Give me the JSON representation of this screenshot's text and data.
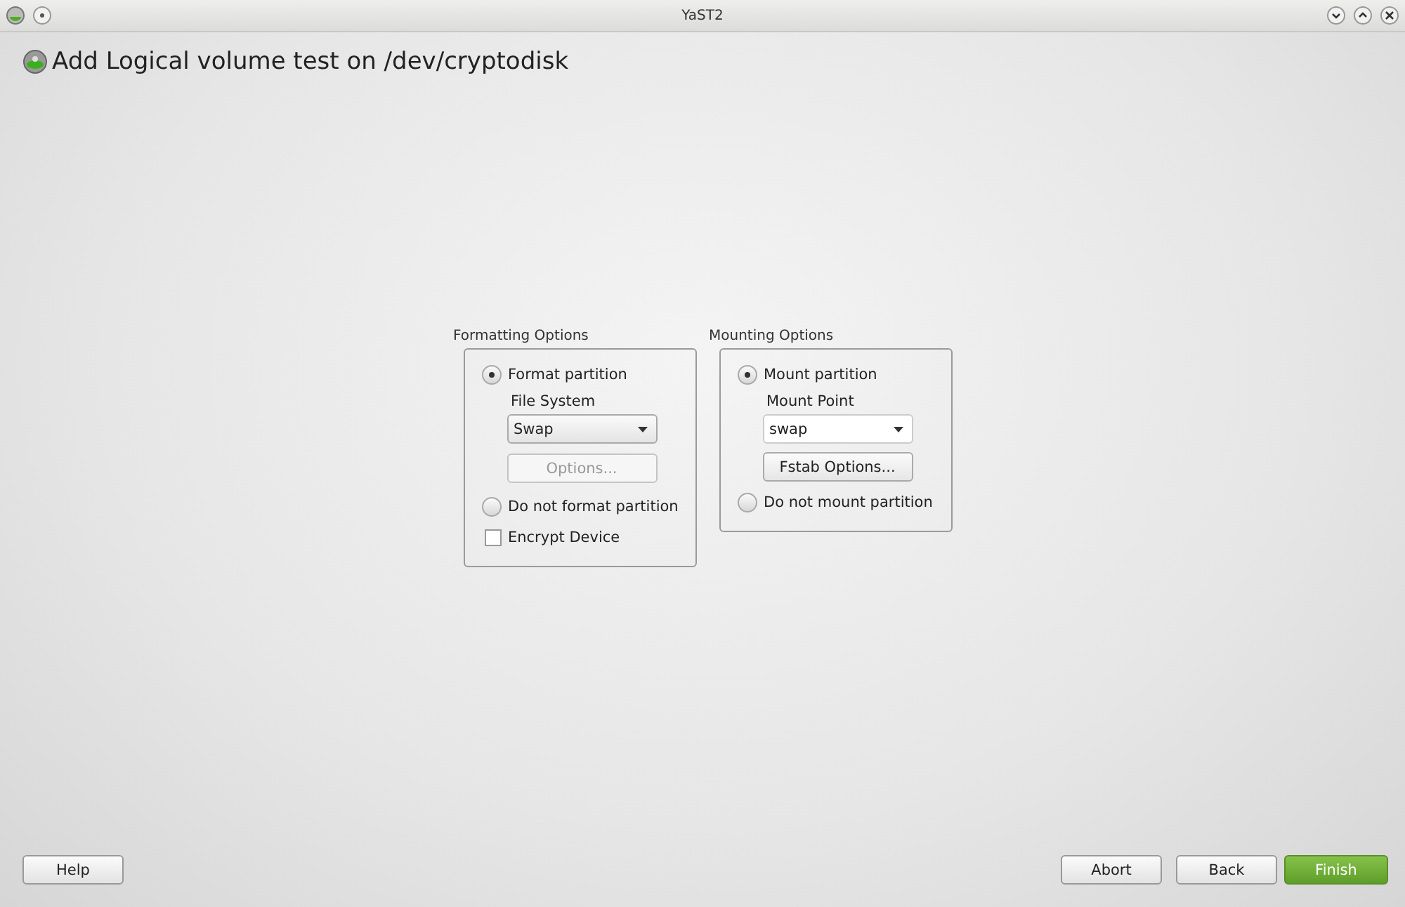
{
  "window": {
    "title": "YaST2"
  },
  "heading": "Add Logical volume test on /dev/cryptodisk",
  "formatting": {
    "legend": "Formatting Options",
    "format_radio": {
      "label": "Format partition",
      "selected": true
    },
    "file_system": {
      "label": "File System",
      "value": "Swap"
    },
    "options_button": {
      "label": "Options...",
      "disabled": true
    },
    "no_format_radio": {
      "label": "Do not format partition",
      "selected": false
    },
    "encrypt": {
      "label": "Encrypt Device",
      "checked": false
    }
  },
  "mounting": {
    "legend": "Mounting Options",
    "mount_radio": {
      "label": "Mount partition",
      "selected": true
    },
    "mount_point": {
      "label": "Mount Point",
      "value": "swap"
    },
    "fstab_button": {
      "label": "Fstab Options...",
      "disabled": false
    },
    "no_mount_radio": {
      "label": "Do not mount partition",
      "selected": false
    }
  },
  "buttons": {
    "help": "Help",
    "abort": "Abort",
    "back": "Back",
    "finish": "Finish"
  }
}
